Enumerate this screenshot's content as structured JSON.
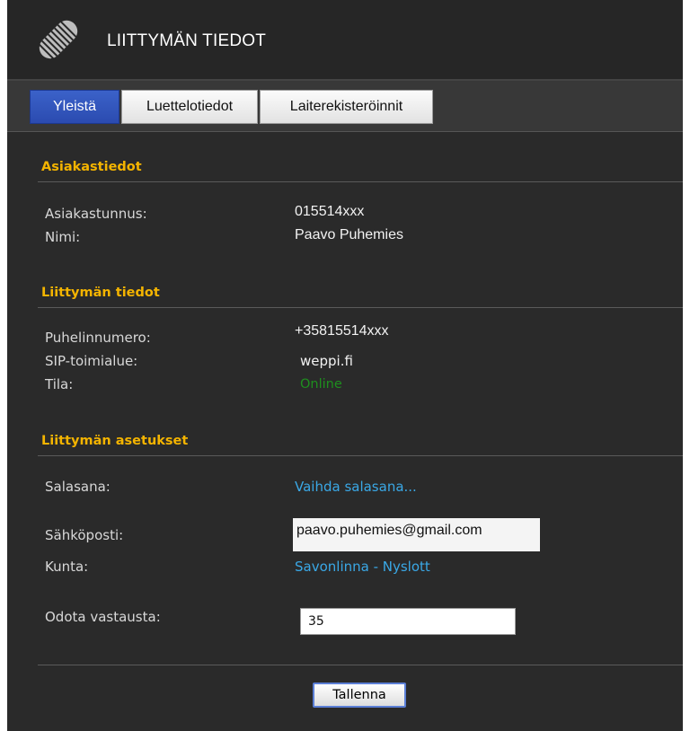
{
  "header": {
    "title": "LIITTYMÄN TIEDOT",
    "logo_icon": "striped-pen-logo"
  },
  "tabs": [
    {
      "label": "Yleistä",
      "active": true
    },
    {
      "label": "Luettelotiedot",
      "active": false
    },
    {
      "label": "Laiterekisteröinnit",
      "active": false
    }
  ],
  "customer": {
    "title": "Asiakastiedot",
    "id_label": "Asiakastunnus:",
    "id_value": "015514xxx",
    "name_label": "Nimi:",
    "name_value": "Paavo Puhemies"
  },
  "subscription": {
    "title": "Liittymän tiedot",
    "phone_label": "Puhelinnumero:",
    "phone_value": "+35815514xxx",
    "sip_label": "SIP-toimialue:",
    "sip_value": "weppi.fi",
    "status_label": "Tila:",
    "status_value": "Online"
  },
  "settings": {
    "title": "Liittymän asetukset",
    "password_label": "Salasana:",
    "password_link": "Vaihda salasana...",
    "email_label": "Sähköposti:",
    "email_value": "paavo.puhemies@gmail.com",
    "municipality_label": "Kunta:",
    "municipality_value": "Savonlinna - Nyslott",
    "wait_label": "Odota vastausta:",
    "wait_value": "35"
  },
  "actions": {
    "save_label": "Tallenna"
  },
  "colors": {
    "accent_heading": "#f4b400",
    "link": "#3aa8e6",
    "status_online": "#1e8f1e",
    "active_tab": "#2b4bb0"
  }
}
